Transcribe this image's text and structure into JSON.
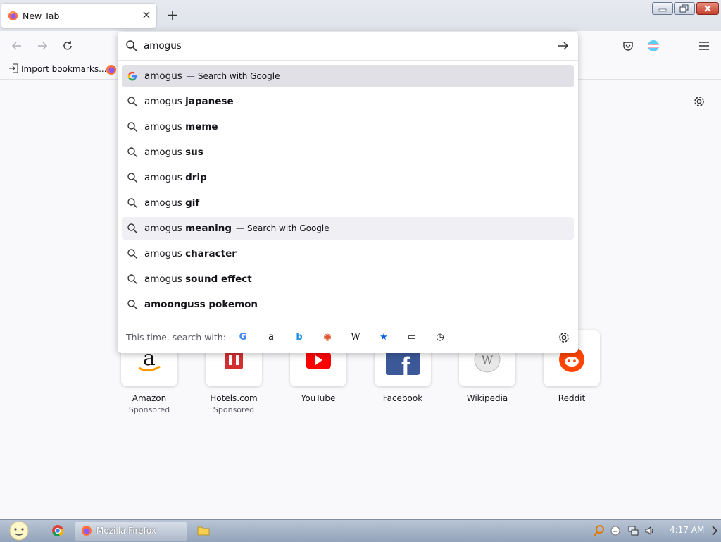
{
  "window": {
    "tab_title": "New Tab",
    "new_tab_symbol": "+",
    "close_tab_symbol": "×"
  },
  "bookmarks_toolbar": {
    "import_label": "Import bookmarks..."
  },
  "urlbar": {
    "value": "amogus",
    "suggestions": [
      {
        "prefix": "amogus",
        "bold": "",
        "separator": "—",
        "action": "Search with Google",
        "icon": "google-icon",
        "selected": true
      },
      {
        "prefix": "amogus",
        "bold": "japanese",
        "separator": "",
        "action": "",
        "icon": "search-icon"
      },
      {
        "prefix": "amogus",
        "bold": "meme",
        "separator": "",
        "action": "",
        "icon": "search-icon"
      },
      {
        "prefix": "amogus",
        "bold": "sus",
        "separator": "",
        "action": "",
        "icon": "search-icon"
      },
      {
        "prefix": "amogus",
        "bold": "drip",
        "separator": "",
        "action": "",
        "icon": "search-icon"
      },
      {
        "prefix": "amogus",
        "bold": "gif",
        "separator": "",
        "action": "",
        "icon": "search-icon"
      },
      {
        "prefix": "amogus",
        "bold": "meaning",
        "separator": "—",
        "action": "Search with Google",
        "icon": "search-icon",
        "hover": true
      },
      {
        "prefix": "amogus",
        "bold": "character",
        "separator": "",
        "action": "",
        "icon": "search-icon"
      },
      {
        "prefix": "amogus",
        "bold": "sound effect",
        "separator": "",
        "action": "",
        "icon": "search-icon"
      },
      {
        "prefix": "",
        "bold": "amoonguss pokemon",
        "separator": "",
        "action": "",
        "icon": "search-icon"
      }
    ],
    "oneoff_label": "This time, search with:",
    "engines": [
      {
        "name": "google",
        "glyph": "G",
        "color": "#4285f4"
      },
      {
        "name": "amazon",
        "glyph": "a",
        "color": "#111111"
      },
      {
        "name": "bing",
        "glyph": "b",
        "color": "#1d8fe1"
      },
      {
        "name": "duckduckgo",
        "glyph": "◉",
        "color": "#de5833"
      },
      {
        "name": "wikipedia",
        "glyph": "W",
        "color": "#111111"
      },
      {
        "name": "bookmarks",
        "glyph": "★",
        "color": "#0060df"
      },
      {
        "name": "tabs",
        "glyph": "▭",
        "color": "#15141a"
      },
      {
        "name": "history",
        "glyph": "◷",
        "color": "#15141a"
      }
    ]
  },
  "topsites": [
    {
      "label": "Amazon",
      "sub": "Sponsored",
      "icon": "amazon-logo-icon"
    },
    {
      "label": "Hotels.com",
      "sub": "Sponsored",
      "icon": "hotels-logo-icon"
    },
    {
      "label": "YouTube",
      "sub": "",
      "icon": "youtube-logo-icon"
    },
    {
      "label": "Facebook",
      "sub": "",
      "icon": "facebook-logo-icon"
    },
    {
      "label": "Wikipedia",
      "sub": "",
      "icon": "wikipedia-logo-icon"
    },
    {
      "label": "Reddit",
      "sub": "",
      "icon": "reddit-logo-icon"
    }
  ],
  "taskbar": {
    "firefox_label": "Mozilla Firefox",
    "clock": "4:17 AM"
  },
  "colors": {
    "accent": "#0060df",
    "selected_row": "#e0e0e6"
  }
}
